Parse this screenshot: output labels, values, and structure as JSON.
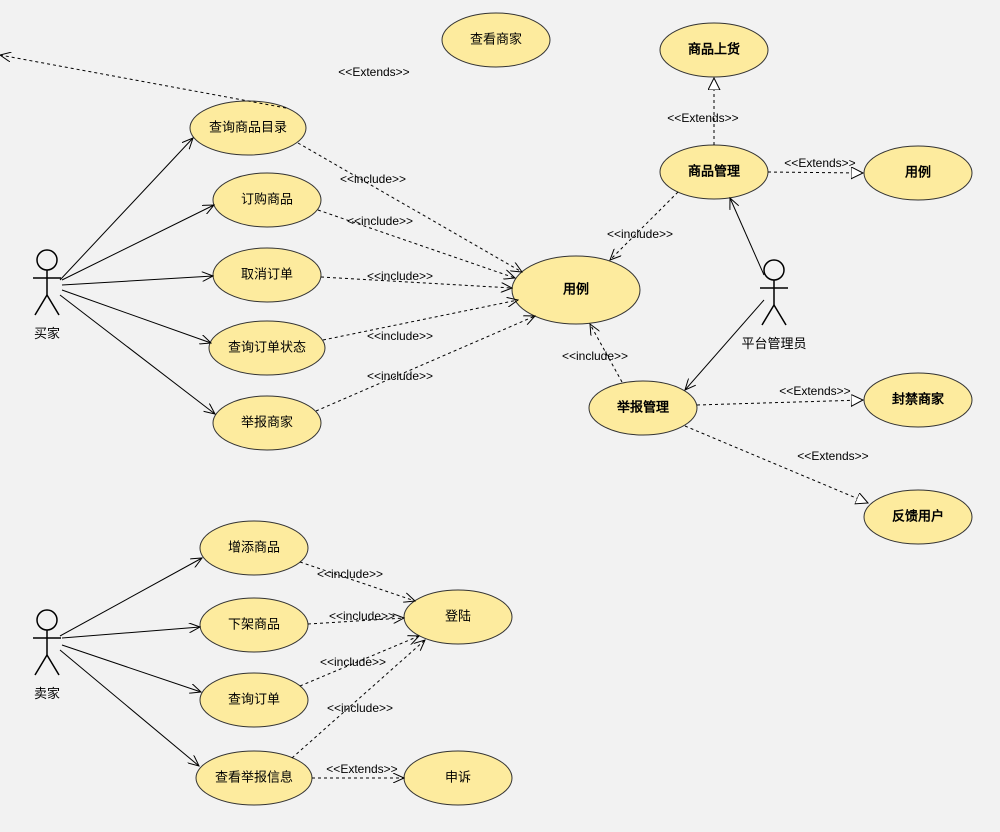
{
  "actors": {
    "buyer": "买家",
    "seller": "卖家",
    "admin": "平台管理员"
  },
  "usecases": {
    "view_merchant": "查看商家",
    "browse_catalog": "查询商品目录",
    "order_goods": "订购商品",
    "cancel_order": "取消订单",
    "query_order_status": "查询订单状态",
    "report_merchant": "举报商家",
    "central_uc": "用例",
    "goods_upload": "商品上货",
    "goods_manage": "商品管理",
    "uc_right": "用例",
    "add_goods": "增添商品",
    "remove_goods": "下架商品",
    "query_orders": "查询订单",
    "view_report_info": "查看举报信息",
    "login": "登陆",
    "appeal": "申诉",
    "report_manage": "举报管理",
    "ban_merchant": "封禁商家",
    "feedback_user": "反馈用户"
  },
  "labels": {
    "extends": "<<Extends>>",
    "include": "<<include>>"
  }
}
